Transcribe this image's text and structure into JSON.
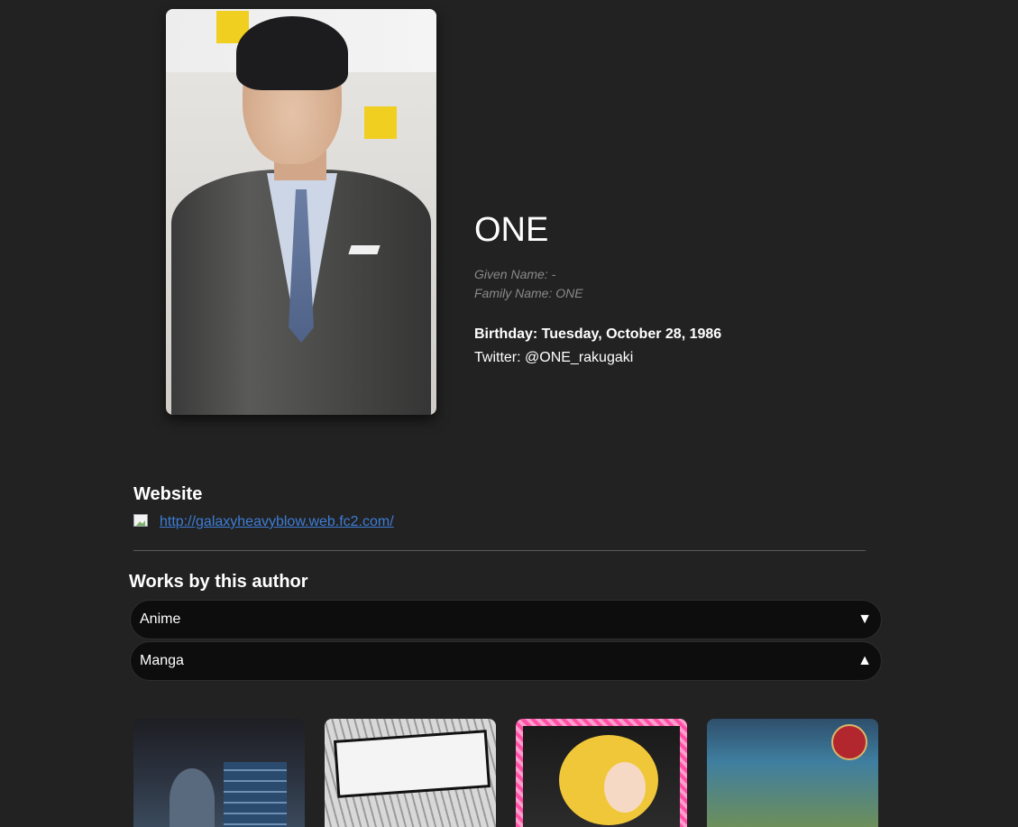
{
  "author": {
    "name": "ONE",
    "given_name": "Given Name: -",
    "family_name": "Family Name: ONE",
    "birthday": "Birthday: Tuesday, October 28, 1986",
    "twitter": "Twitter: @ONE_rakugaki"
  },
  "website": {
    "heading": "Website",
    "url": "http://galaxyheavyblow.web.fc2.com/"
  },
  "works": {
    "heading": "Works by this author",
    "sections": [
      {
        "label": "Anime",
        "arrow": "▼"
      },
      {
        "label": "Manga",
        "arrow": "▲"
      }
    ]
  }
}
